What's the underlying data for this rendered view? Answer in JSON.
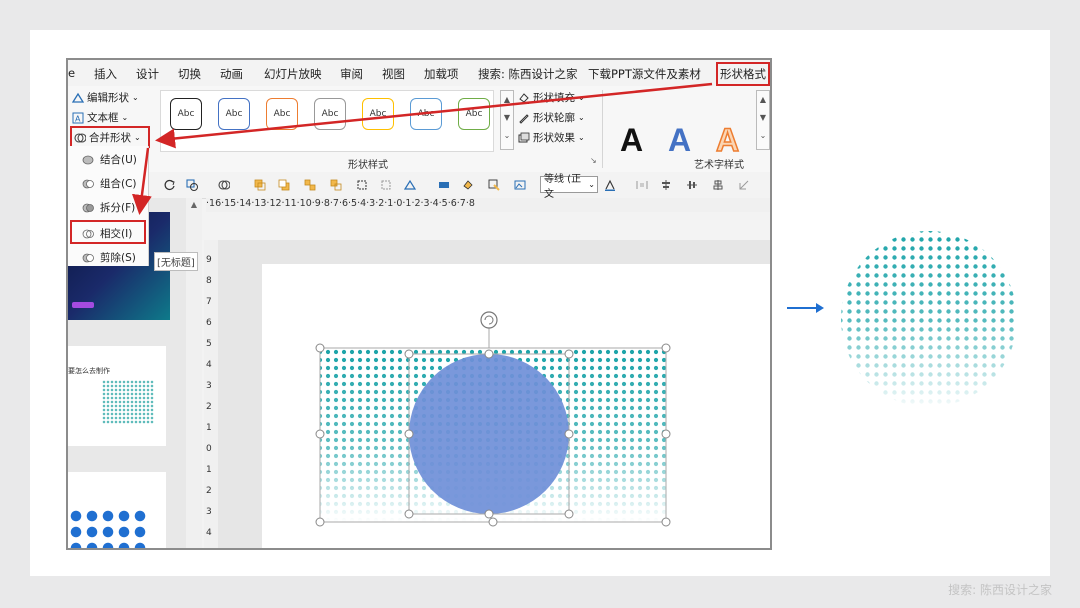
{
  "menubar": {
    "items": [
      "e",
      "插入",
      "设计",
      "切换",
      "动画",
      "幻灯片放映",
      "审阅",
      "视图",
      "加载项",
      "搜索: 陈西设计之家",
      "下载PPT源文件及素材",
      "形状格式"
    ]
  },
  "ribbon": {
    "edit_shape": "编辑形状",
    "text_box": "文本框",
    "merge_shapes": "合并形状",
    "style_sample": "Abc",
    "shape_fill": "形状填充",
    "shape_outline": "形状轮廓",
    "shape_effects": "形状效果",
    "shape_styles_group": "形状样式",
    "wordart_group": "艺术字样式",
    "wordart_letter": "A"
  },
  "merge_menu": {
    "items": [
      "结合(U)",
      "组合(C)",
      "拆分(F)",
      "相交(I)",
      "剪除(S)"
    ]
  },
  "toolbar2": {
    "font": "等线 (正文"
  },
  "tooltip": "[无标题]",
  "ruler_h": "·16·15·14·13·12·11·10·9·8·7·6·5·4·3·2·1·0·1·2·3·4·5·6·7·8",
  "ruler_v": [
    "9",
    "8",
    "7",
    "6",
    "5",
    "4",
    "3",
    "2",
    "1",
    "0",
    "1",
    "2",
    "3",
    "4"
  ],
  "slide_thumbs": {
    "thumb2_title": "要怎么去制作"
  },
  "watermark": "搜索: 陈西设计之家",
  "colors": {
    "accent_red": "#d32626",
    "dot_teal": "#1aa3a8",
    "dot_blue": "#2f6fa0",
    "circle_fill": "#6f8fd8",
    "arrow_blue": "#1f6fd1"
  }
}
